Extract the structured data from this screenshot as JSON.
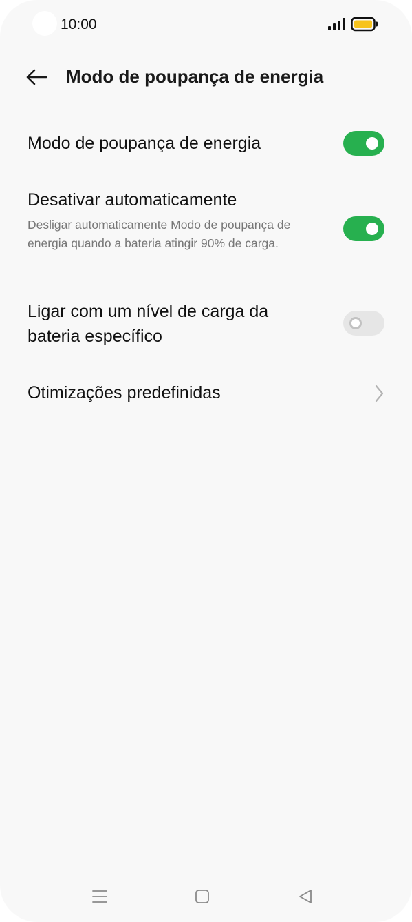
{
  "status_bar": {
    "time": "10:00",
    "battery_color": "#f7c31c"
  },
  "header": {
    "title": "Modo de poupança de energia",
    "back_icon": "arrow-left-icon"
  },
  "settings": {
    "power_saving": {
      "title": "Modo de poupança de energia",
      "enabled": true
    },
    "auto_disable": {
      "title": "Desativar automaticamente",
      "subtitle": "Desligar automaticamente Modo de poupança de energia quando a bateria atingir 90% de carga.",
      "enabled": true
    },
    "specific_level": {
      "title": "Ligar com um nível de carga da bateria específico",
      "enabled": false
    },
    "presets": {
      "title": "Otimizações predefinidas"
    }
  },
  "colors": {
    "toggle_on": "#27b04f",
    "toggle_off": "#e6e6e6",
    "background": "#f8f8f8"
  }
}
